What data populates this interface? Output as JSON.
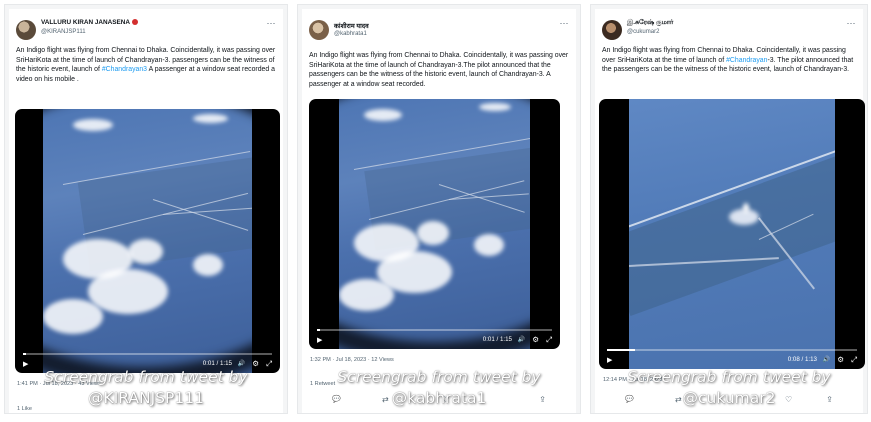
{
  "panels": [
    {
      "display_name": "VALLURU KIRAN JANASENA",
      "handle": "@KIRANJSP111",
      "more_icon": "⋯",
      "text_before_hashtag": "An Indigo flight was flying from Chennai to Dhaka. Coincidentally, it was passing over SriHariKota at the time of launch of Chandrayan-3. passengers can be the witness of the historic event, launch of ",
      "hashtag": "#Chandrayan3",
      "text_after_hashtag": " A passenger at a window seat recorded a video on his mobile .",
      "video": {
        "time": "0:01 / 1:15",
        "progress": 0.013
      },
      "timestamp": "1:41 PM · Jul 18, 2023 · 43 Views",
      "footer_stat": "1 Like",
      "caption_line1": "Screengrab from tweet by",
      "caption_line2": "@KIRANJSP111"
    },
    {
      "display_name": "कांशीराम यादव",
      "handle": "@kabhrata1",
      "more_icon": "⋯",
      "text_before_hashtag": "An Indigo flight was flying from Chennai to Dhaka. Coincidentally, it was passing over SriHariKota at the time of launch of Chandrayan-3.The pilot announced that the passengers can be the witness of the historic event, launch of Chandrayan-3. A passenger at a window seat recorded.",
      "hashtag": "",
      "text_after_hashtag": "",
      "video": {
        "time": "0:01 / 1:15",
        "progress": 0.013
      },
      "timestamp": "1:32 PM · Jul 18, 2023 · 12 Views",
      "footer_stat": "1 Retweet",
      "caption_line1": "Screengrab from tweet by",
      "caption_line2": "@kabhrata1"
    },
    {
      "display_name": "இ.சுரேஷ் குமார்",
      "handle": "@cukumar2",
      "more_icon": "⋯",
      "text_before_hashtag": "An Indigo flight was flying from Chennai to Dhaka. Coincidentally, it was passing over SriHariKota at the time of launch of ",
      "hashtag": "#Chandrayan",
      "text_after_hashtag": "-3. The pilot announced that the passengers can be the witness of the historic event, launch of Chandrayan-3.",
      "video": {
        "time": "0:08 / 1:13",
        "progress": 0.11
      },
      "timestamp": "12:14 PM · Jul 18, 2023",
      "footer_stat": "",
      "caption_line1": "Screengrab from tweet by",
      "caption_line2": "@cukumar2"
    }
  ],
  "icons": {
    "play": "▶",
    "volume": "🔊",
    "settings": "⚙",
    "fullscreen": "⤢",
    "reply": "💬",
    "retweet": "⇄",
    "like": "♡",
    "share": "⇪"
  },
  "colors": {
    "link": "#1d9bf0",
    "sky": "#4e76b4",
    "caption": "#ffffff"
  }
}
